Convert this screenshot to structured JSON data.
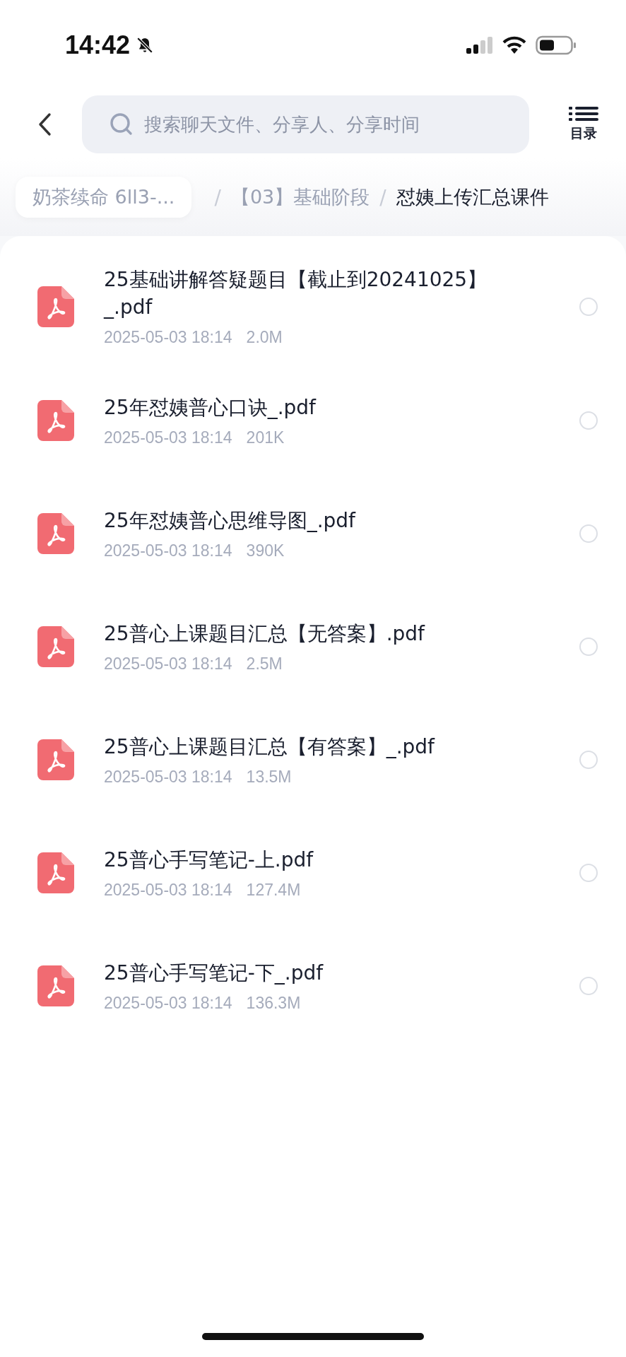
{
  "status_bar": {
    "time": "14:42",
    "muted": true
  },
  "search": {
    "placeholder": "搜索聊天文件、分享人、分享时间"
  },
  "catalog_button": {
    "label": "目录"
  },
  "breadcrumb": [
    {
      "label": "奶茶续命 6ll3-...",
      "kind": "chip"
    },
    {
      "label": "/",
      "kind": "separator"
    },
    {
      "label": "【03】基础阶段",
      "kind": "link"
    },
    {
      "label": "/",
      "kind": "separator"
    },
    {
      "label": "怼姨上传汇总课件",
      "kind": "current"
    }
  ],
  "files": [
    {
      "name": "25基础讲解答疑题目【截止到20241025】_.pdf",
      "date": "2025-05-03 18:14",
      "size": "2.0M",
      "selected": false
    },
    {
      "name": "25年怼姨普心口诀_.pdf",
      "date": "2025-05-03 18:14",
      "size": "201K",
      "selected": false
    },
    {
      "name": "25年怼姨普心思维导图_.pdf",
      "date": "2025-05-03 18:14",
      "size": "390K",
      "selected": false
    },
    {
      "name": "25普心上课题目汇总【无答案】.pdf",
      "date": "2025-05-03 18:14",
      "size": "2.5M",
      "selected": false
    },
    {
      "name": "25普心上课题目汇总【有答案】_.pdf",
      "date": "2025-05-03 18:14",
      "size": "13.5M",
      "selected": false
    },
    {
      "name": "25普心手写笔记-上.pdf",
      "date": "2025-05-03 18:14",
      "size": "127.4M",
      "selected": false
    },
    {
      "name": "25普心手写笔记-下_.pdf",
      "date": "2025-05-03 18:14",
      "size": "136.3M",
      "selected": false
    }
  ]
}
